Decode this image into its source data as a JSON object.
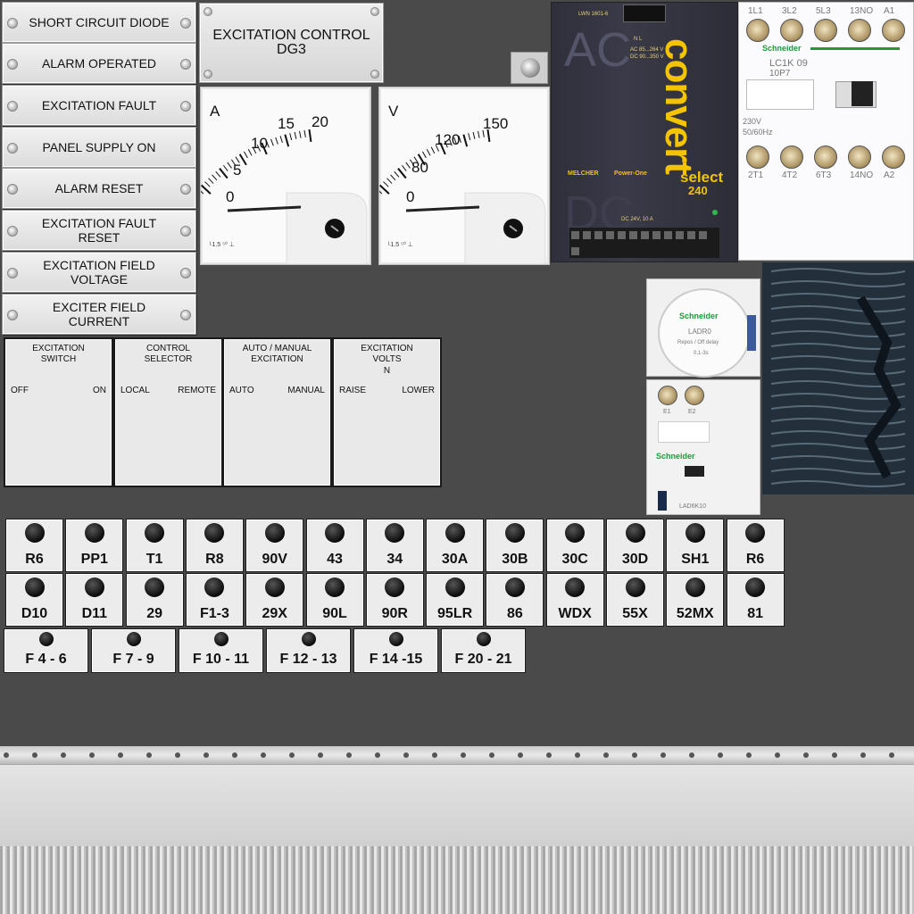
{
  "nameplates": [
    {
      "label": "SHORT CIRCUIT DIODE"
    },
    {
      "label": "ALARM OPERATED"
    },
    {
      "label": "EXCITATION FAULT"
    },
    {
      "label": "PANEL SUPPLY ON"
    },
    {
      "label": "ALARM RESET"
    },
    {
      "label": "EXCITATION FAULT RESET"
    },
    {
      "label": "EXCITATION FIELD VOLTAGE"
    },
    {
      "label": "EXCITER FIELD CURRENT"
    }
  ],
  "title_plate": {
    "line1": "EXCITATION CONTROL",
    "line2": "DG3"
  },
  "ammeter": {
    "unit": "A",
    "ticks": [
      "0",
      "5",
      "10",
      "15",
      "20"
    ],
    "reading": 0
  },
  "voltmeter": {
    "unit": "V",
    "ticks": [
      "0",
      "80",
      "120",
      "150"
    ],
    "reading": 0
  },
  "switches": [
    {
      "title": "EXCITATION SWITCH",
      "left": "OFF",
      "right": "ON",
      "center": ""
    },
    {
      "title": "CONTROL SELECTOR",
      "left": "LOCAL",
      "right": "REMOTE",
      "center": ""
    },
    {
      "title": "AUTO / MANUAL EXCITATION",
      "left": "AUTO",
      "right": "MANUAL",
      "center": ""
    },
    {
      "title": "EXCITATION VOLTS",
      "left": "RAISE",
      "right": "LOWER",
      "center": "N"
    }
  ],
  "indicators_row1": [
    "R6",
    "PP1",
    "T1",
    "R8",
    "90V",
    "43",
    "34",
    "30A",
    "30B",
    "30C",
    "30D",
    "SH1",
    "R6"
  ],
  "indicators_row2": [
    "D10",
    "D11",
    "29",
    "F1-3",
    "29X",
    "90L",
    "90R",
    "95LR",
    "86",
    "WDX",
    "55X",
    "52MX",
    "81"
  ],
  "fuses": [
    "F 4 - 6",
    "F 7 - 9",
    "F 10 - 11",
    "F 12 - 13",
    "F 14 -15",
    "F 20 - 21"
  ],
  "psu": {
    "big_top": "AC",
    "big_bottom": "DC",
    "brand": "convert",
    "model": "select",
    "model_num": "240",
    "part": "LWN 1601-6",
    "ac_in": "AC  85...264 V",
    "dc_in": "DC  90...350 V",
    "output": "DC 24V, 10 A",
    "maker": "MELCHER",
    "maker2": "Power-One",
    "term_labels": "N  L"
  },
  "contactor": {
    "top_terms": [
      "1L1",
      "3L2",
      "5L3",
      "13NO",
      "A1"
    ],
    "bottom_terms": [
      "2T1",
      "4T2",
      "6T3",
      "14NO",
      "A2"
    ],
    "brand": "Schneider",
    "model": "LC1K 09",
    "model2": "10P7",
    "rating": "230V",
    "freq": "50/60Hz"
  },
  "timer": {
    "brand": "Schneider",
    "model": "LADR0",
    "desc": "Repos / Off delay",
    "range": "0,1-3s"
  },
  "module": {
    "brand": "Schneider",
    "terms": [
      "E1",
      "E2"
    ],
    "model": "LAD6K10"
  },
  "colors": {
    "panel": "#4a4a4a",
    "plate": "#e8e8e8",
    "psu": "#33333f",
    "psu_text": "#f4c400",
    "brand_green": "#1f9a3a"
  }
}
